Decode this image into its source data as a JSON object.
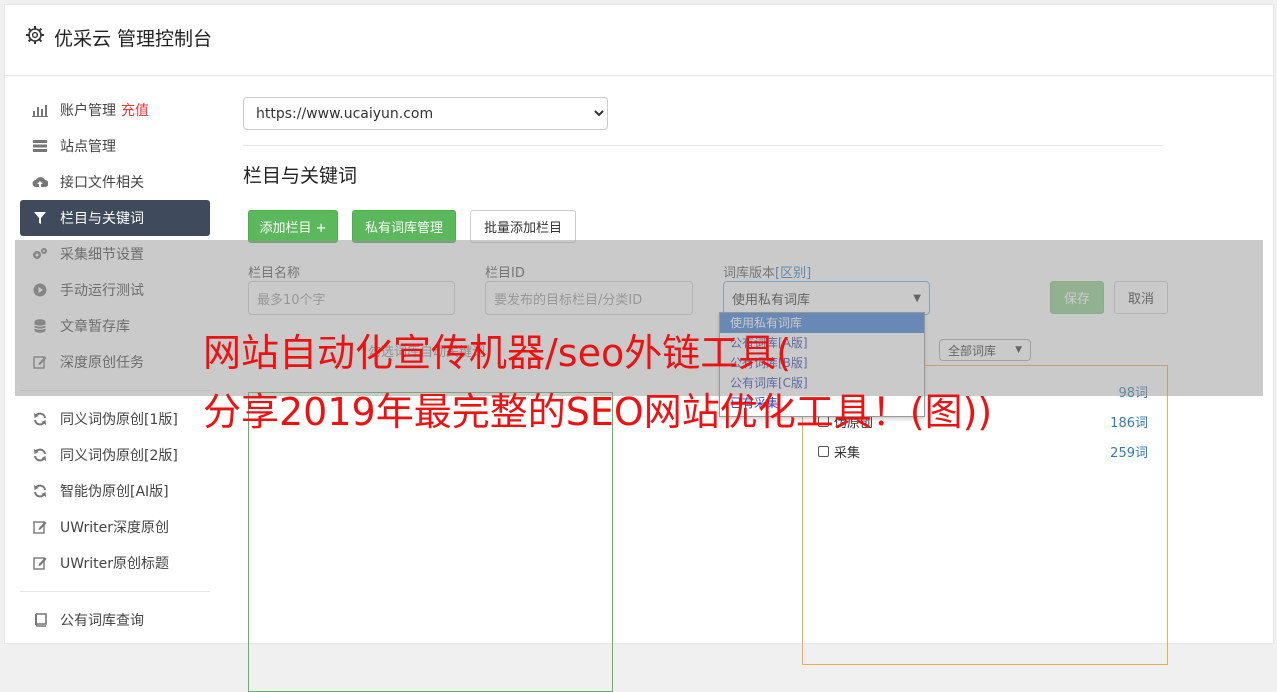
{
  "header": {
    "title": "优采云 管理控制台",
    "icon": "gear-icon"
  },
  "sidebar": {
    "items": [
      {
        "label": "账户管理",
        "badge": "充值",
        "icon": "bar-chart-icon"
      },
      {
        "label": "站点管理",
        "icon": "server-icon"
      },
      {
        "label": "接口文件相关",
        "icon": "cloud-upload-icon"
      },
      {
        "label": "栏目与关键词",
        "icon": "filter-icon",
        "active": true
      },
      {
        "label": "采集细节设置",
        "icon": "cogs-icon"
      },
      {
        "label": "手动运行测试",
        "icon": "play-icon"
      },
      {
        "label": "文章暂存库",
        "icon": "database-icon"
      },
      {
        "label": "深度原创任务",
        "icon": "edit-icon"
      }
    ],
    "items2": [
      {
        "label": "同义词伪原创[1版]",
        "icon": "refresh-icon"
      },
      {
        "label": "同义词伪原创[2版]",
        "icon": "refresh-icon"
      },
      {
        "label": "智能伪原创[AI版]",
        "icon": "refresh-icon"
      },
      {
        "label": "UWriter深度原创",
        "icon": "edit-icon"
      },
      {
        "label": "UWriter原创标题",
        "icon": "edit-icon"
      }
    ],
    "items3": [
      {
        "label": "公有词库查询",
        "icon": "book-icon"
      }
    ]
  },
  "main": {
    "site_select": "https://www.ucaiyun.com",
    "section_title": "栏目与关键词",
    "buttons": {
      "add": "添加栏目 +",
      "private": "私有词库管理",
      "batch": "批量添加栏目"
    },
    "form": {
      "name_label": "栏目名称",
      "name_placeholder": "最多10个字",
      "id_label": "栏目ID",
      "id_placeholder": "要发布的目标栏目/分类ID",
      "version_label": "词库版本",
      "version_link": "[区别]",
      "version_value": "使用私有词库",
      "save": "保存",
      "cancel": "取消"
    },
    "dropdown": [
      "使用私有词库",
      "公有词库[A版]",
      "公有词库[B版]",
      "公有词库[C版]",
      "已有采集"
    ],
    "filter_select": "全部词库",
    "left_panel_hint": "勾选词库自动关键词",
    "right_rows": [
      {
        "label": "",
        "count": "98词"
      },
      {
        "label": "伪原创",
        "count": "186词"
      },
      {
        "label": "采集",
        "count": "259词"
      }
    ]
  },
  "overlay": {
    "line1": "网站自动化宣传机器/seo外链工具(",
    "line2": "分享2019年最完整的SEO网站优化工具！(图))"
  }
}
